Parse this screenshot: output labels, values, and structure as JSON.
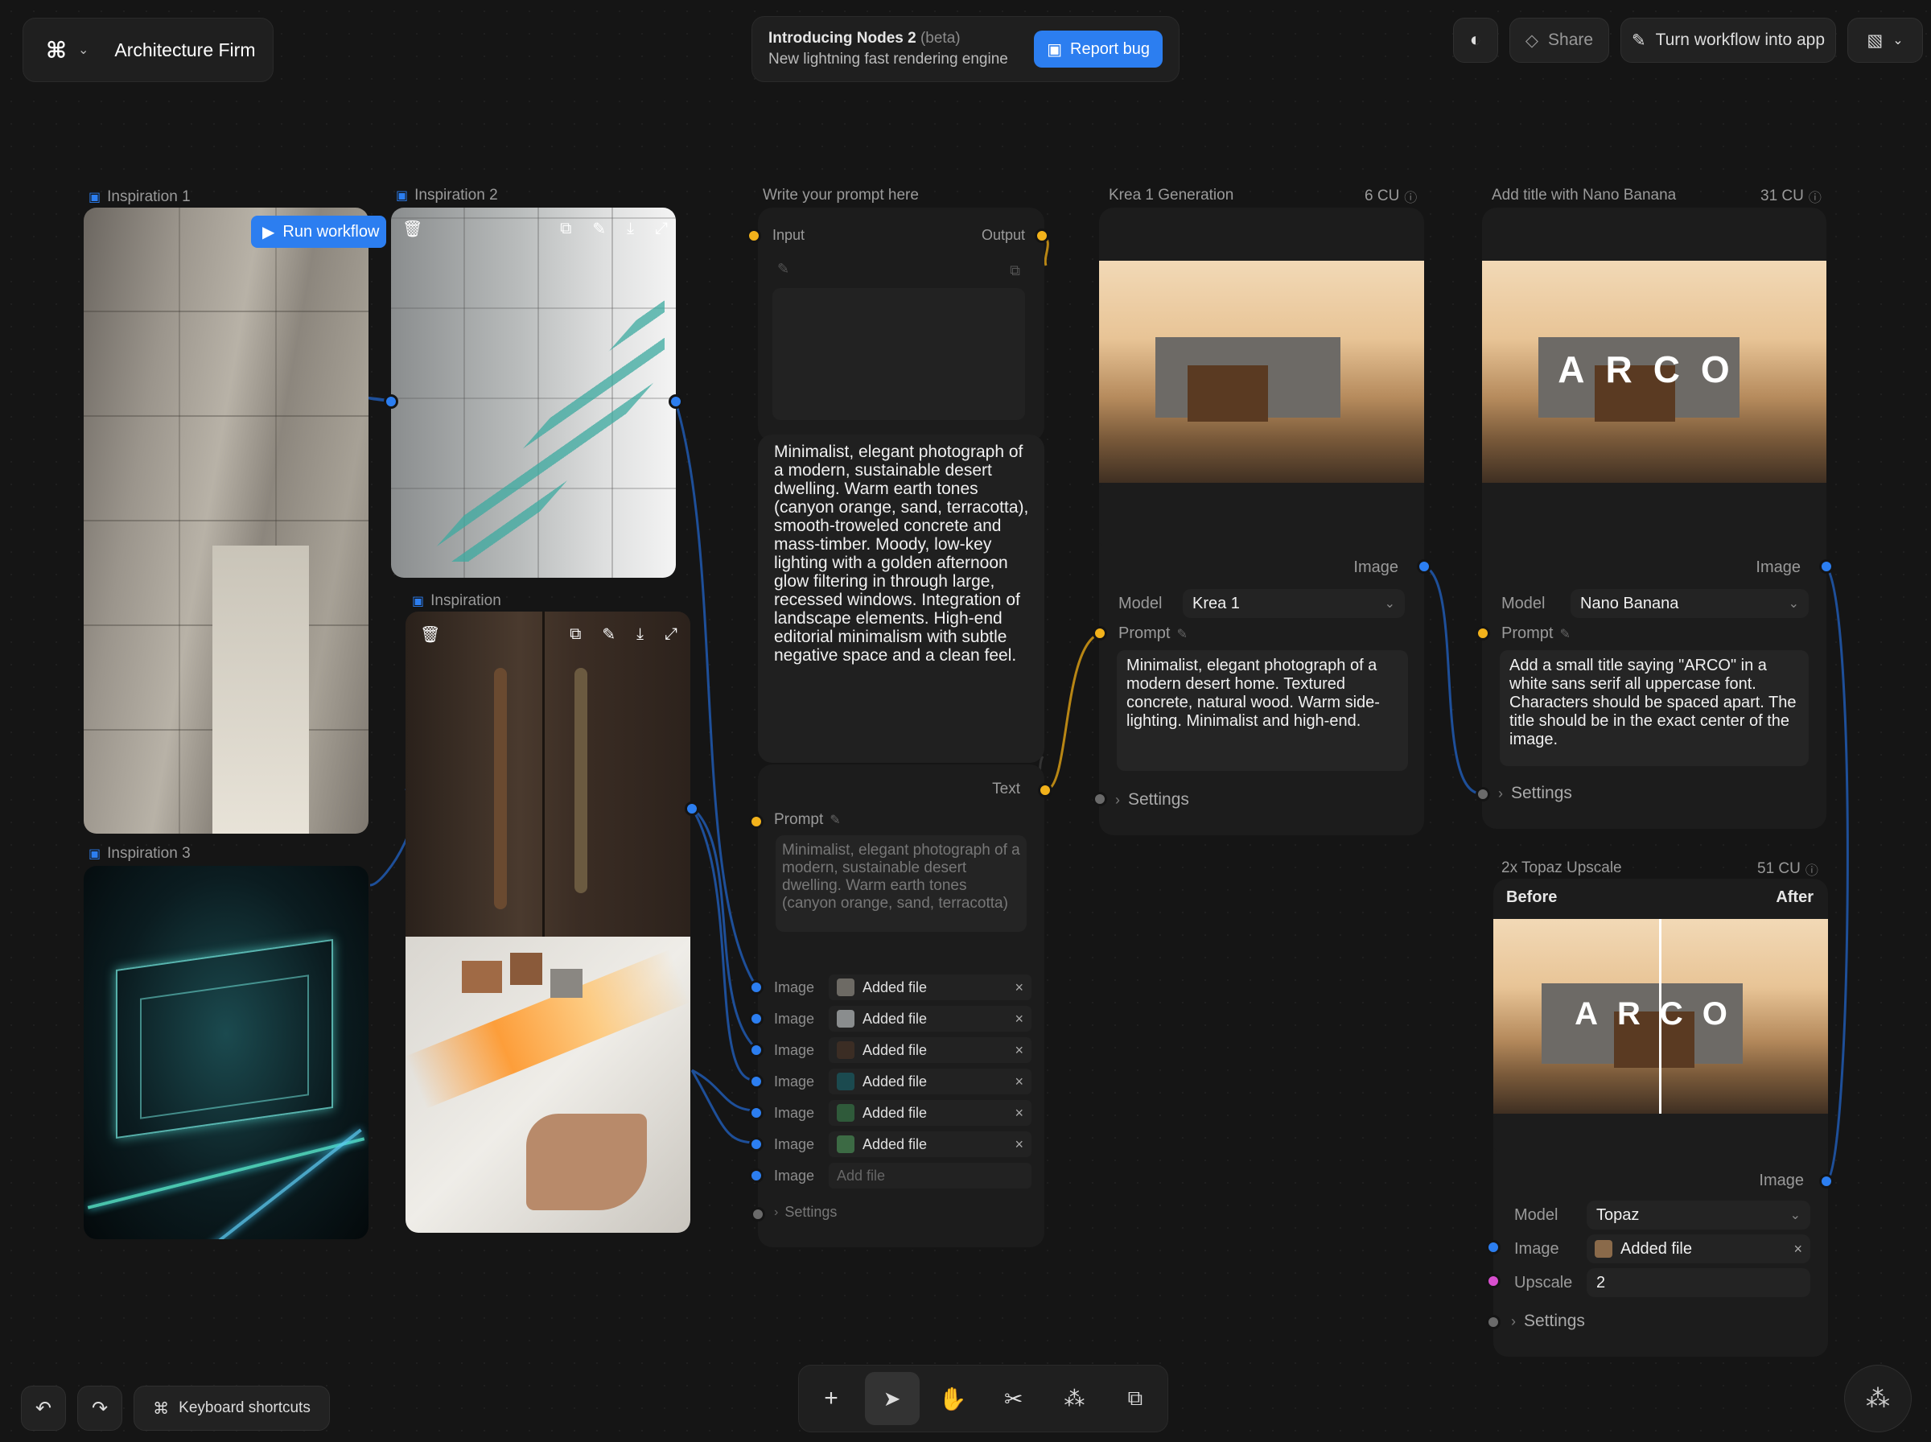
{
  "header": {
    "project_name": "Architecture Firm",
    "announcement_title": "Introducing Nodes 2",
    "announcement_tag": "(beta)",
    "announcement_sub": "New lightning fast rendering engine",
    "report_bug": "Report bug",
    "share": "Share",
    "turn_into_app": "Turn workflow into app"
  },
  "inspirations": {
    "i1": "Inspiration 1",
    "i2": "Inspiration 2",
    "i3": "Inspiration 3",
    "i": "Inspiration",
    "run_workflow": "Run workflow"
  },
  "prompt_node": {
    "title": "Write your prompt here",
    "input": "Input",
    "output": "Output",
    "text": "Minimalist, elegant photograph of a modern, sustainable desert dwelling. Warm earth tones (canyon orange, sand, terracotta), smooth-troweled concrete and mass-timber. Moody, low-key lighting with a golden afternoon glow filtering in through large, recessed windows. Integration of landscape elements. High-end editorial minimalism with subtle negative space and a clean feel.",
    "text_label": "Text",
    "prompt_label": "Prompt",
    "prompt_preview": "Minimalist, elegant photograph of a modern, sustainable desert dwelling. Warm earth tones (canyon orange, sand, terracotta)",
    "image_label": "Image",
    "added_file": "Added file",
    "add_file": "Add file",
    "settings": "Settings"
  },
  "krea": {
    "title": "Krea 1 Generation",
    "cost": "6 CU",
    "image_label": "Image",
    "model_label": "Model",
    "model_value": "Krea 1",
    "prompt_label": "Prompt",
    "prompt_text": "Minimalist, elegant photograph of a modern desert home. Textured concrete, natural wood. Warm side-lighting. Minimalist and high-end.",
    "settings": "Settings"
  },
  "nano": {
    "title": "Add title with Nano Banana",
    "cost": "31 CU",
    "overlay": "ARCO",
    "image_label": "Image",
    "model_label": "Model",
    "model_value": "Nano Banana",
    "prompt_label": "Prompt",
    "prompt_text": "Add a small title saying \"ARCO\" in a white sans serif all uppercase font. Characters should be spaced apart. The title should be in the exact center of the image.",
    "settings": "Settings"
  },
  "topaz": {
    "title": "2x Topaz Upscale",
    "cost": "51 CU",
    "before": "Before",
    "after": "After",
    "overlay": "ARCO",
    "image_label": "Image",
    "model_label": "Model",
    "model_value": "Topaz",
    "image_input_label": "Image",
    "image_input_value": "Added file",
    "upscale_label": "Upscale",
    "upscale_value": "2",
    "settings": "Settings"
  },
  "footer": {
    "keyboard_shortcuts": "Keyboard shortcuts"
  },
  "colors": {
    "accent_blue": "#2c7ef0",
    "port_yellow": "#f2b21b",
    "port_pink": "#d84fcf"
  }
}
